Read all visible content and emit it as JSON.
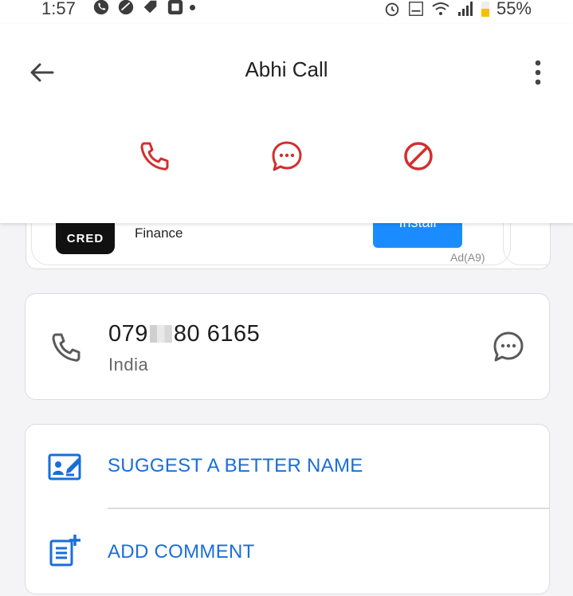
{
  "status_bar": {
    "time": "1:57",
    "battery": "55%"
  },
  "header": {
    "title": "Abhi Call"
  },
  "ad": {
    "brand": "CRED",
    "category": "Finance",
    "install_label": "Install",
    "ad_label": "Ad(A9)"
  },
  "contact": {
    "number_prefix": "079",
    "number_suffix": "80 6165",
    "country": "India"
  },
  "options": {
    "suggest_label": "SUGGEST A BETTER NAME",
    "comment_label": "ADD COMMENT"
  },
  "colors": {
    "accent_red": "#d32f2f",
    "accent_blue": "#1a6ed8",
    "install_blue": "#1a8cff"
  }
}
